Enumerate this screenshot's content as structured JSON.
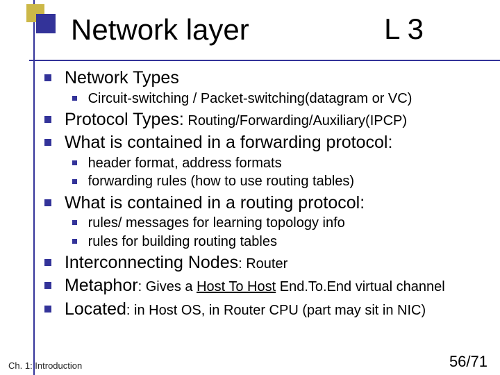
{
  "title": {
    "left": "Network layer",
    "right": "L 3"
  },
  "items": [
    {
      "label": "Network Types",
      "subs": [
        {
          "text": "Circuit-switching / Packet-switching(datagram or VC)"
        }
      ]
    },
    {
      "label_pre": "Protocol Types:",
      "label_post": " Routing/Forwarding/Auxiliary(IPCP)"
    },
    {
      "label": "What is contained in a forwarding protocol:",
      "subs": [
        {
          "text": "header format, address formats"
        },
        {
          "text": "forwarding rules (how to use routing tables)"
        }
      ]
    },
    {
      "label": "What is contained in a routing protocol:",
      "subs": [
        {
          "text": "rules/ messages for learning topology info"
        },
        {
          "text": "rules for building routing tables"
        }
      ]
    },
    {
      "label_pre": "Interconnecting Nodes",
      "label_post": ": Router"
    },
    {
      "label_pre": "Metaphor",
      "label_mid": ": Gives a ",
      "label_u": "Host To Host",
      "label_end": " End.To.End virtual channel"
    },
    {
      "label_pre": "Located",
      "label_post": ": in Host OS, in Router CPU (part may sit in NIC)"
    }
  ],
  "footer": "Ch. 1: Introduction",
  "pagenum": "56/71"
}
